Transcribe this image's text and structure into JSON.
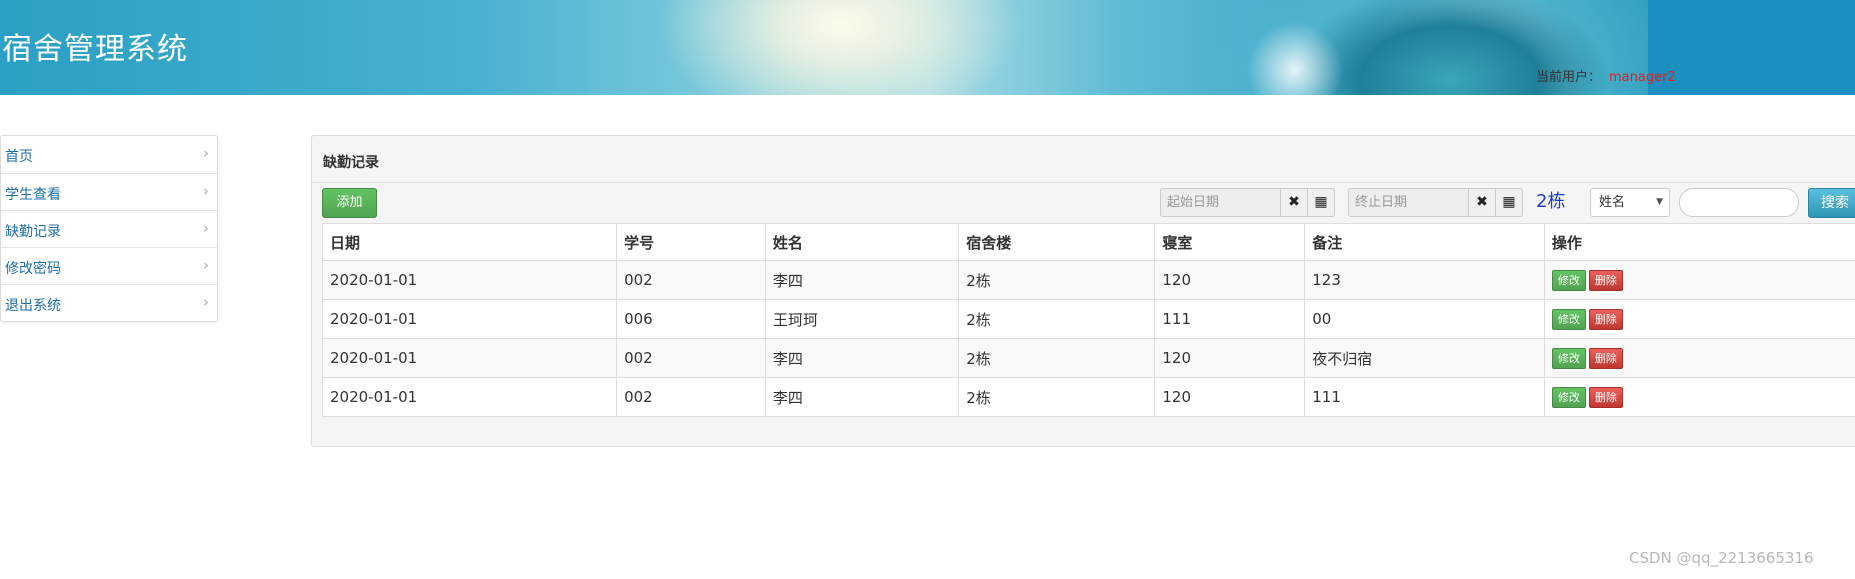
{
  "header": {
    "title": "宿舍管理系统",
    "user_label": "当前用户：",
    "user_name": "manager2"
  },
  "sidebar": {
    "items": [
      {
        "label": "首页"
      },
      {
        "label": "学生查看"
      },
      {
        "label": "缺勤记录"
      },
      {
        "label": "修改密码"
      },
      {
        "label": "退出系统"
      }
    ]
  },
  "panel": {
    "title": "缺勤记录",
    "add_label": "添加",
    "start_date_placeholder": "起始日期",
    "end_date_placeholder": "终止日期",
    "building": "2栋",
    "search_field_selected": "姓名",
    "search_value": "",
    "search_label": "搜索"
  },
  "table": {
    "headers": [
      "日期",
      "学号",
      "姓名",
      "宿舍楼",
      "寝室",
      "备注",
      "操作"
    ],
    "edit_label": "修改",
    "delete_label": "删除",
    "rows": [
      {
        "date": "2020-01-01",
        "student_id": "002",
        "name": "李四",
        "building": "2栋",
        "room": "120",
        "remark": "123"
      },
      {
        "date": "2020-01-01",
        "student_id": "006",
        "name": "王珂珂",
        "building": "2栋",
        "room": "111",
        "remark": "00"
      },
      {
        "date": "2020-01-01",
        "student_id": "002",
        "name": "李四",
        "building": "2栋",
        "room": "120",
        "remark": "夜不归宿"
      },
      {
        "date": "2020-01-01",
        "student_id": "002",
        "name": "李四",
        "building": "2栋",
        "room": "120",
        "remark": "111"
      }
    ]
  },
  "icons": {
    "clear": "times-icon",
    "calendar": "grid-icon",
    "chevron": "chevron-right-icon"
  },
  "colors": {
    "header_bg": "#2aa0c4",
    "user_name": "#e02020",
    "link": "#1f6fa8",
    "building": "#1f3fcf",
    "btn_success": "#51a351",
    "btn_danger": "#bd362f",
    "btn_info": "#2f96b4"
  },
  "watermark": "CSDN @qq_2213665316"
}
